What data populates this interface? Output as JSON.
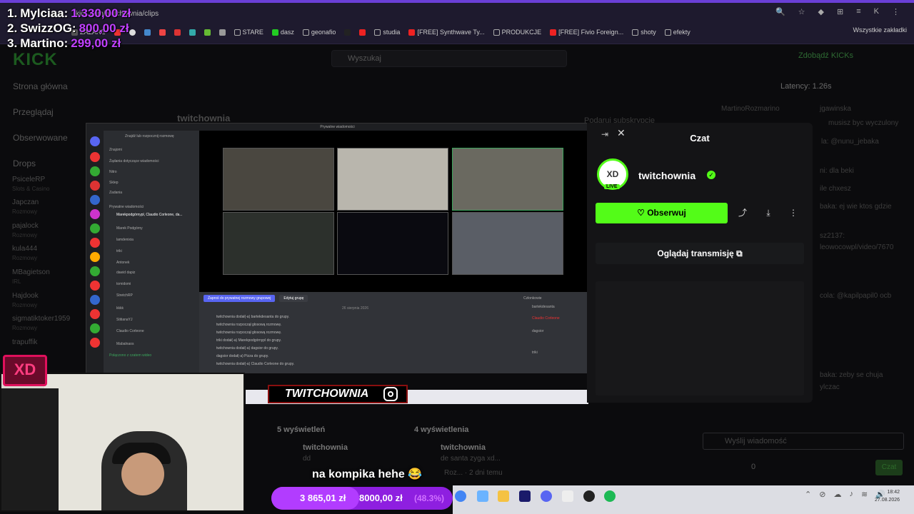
{
  "browser": {
    "url": "kick.com/twitchownia/clips",
    "bookmarks": [
      "ZAZARE",
      "STARE",
      "dasz",
      "geonafio",
      "studia",
      "[FREE] Synthwave Ty...",
      "PRODUKCJE",
      "[FREE] Fivio Foreign...",
      "shoty",
      "efekty"
    ],
    "bookmarks_all": "Wszystkie zakładki",
    "profile_letter": "K"
  },
  "leaderboard": [
    {
      "rank": "1.",
      "name": "Mylciaa:",
      "amount": "1.330,00 zł"
    },
    {
      "rank": "2.",
      "name": "SwizzOG:",
      "amount": "800,00 zł"
    },
    {
      "rank": "3.",
      "name": "Martino:",
      "amount": "299,00 zł"
    }
  ],
  "kick": {
    "logo": "KICK",
    "search_placeholder": "Wyszukaj",
    "get_kicks": "Zdobądź KICKs",
    "nav": [
      "Strona główna",
      "Przeglądaj",
      "Obserwowane"
    ],
    "drops": "Drops",
    "channels": [
      {
        "name": "PsiceleRP",
        "sub": "Slots & Casino"
      },
      {
        "name": "Japczan",
        "sub": "Rozmowy"
      },
      {
        "name": "pajalock",
        "sub": "Rozmowy"
      },
      {
        "name": "kula444",
        "sub": "Rozmowy"
      },
      {
        "name": "MBagietson",
        "sub": "IRL"
      },
      {
        "name": "Hajdook",
        "sub": "Rozmowy"
      },
      {
        "name": "sigmatiktoker1959",
        "sub": "Rozmowy"
      },
      {
        "name": "trapuffik",
        "sub": ""
      }
    ],
    "channel_name": "twitchownia",
    "subscribe": "Podaruj subskrypcję",
    "latency": "Latency: 1.26s",
    "chat_placeholder": "Wyślij wiadomość",
    "chat_btn": "Czat",
    "points": "0",
    "chat_lines": [
      "MartinoRozmarino",
      "jgawinska",
      "musisz byc wyczulony",
      "la: @nunu_jebaka",
      "ni: dla beki",
      "ile chxesz",
      "baka: ej wie ktos gdzie",
      "sz2137:",
      "leowocowpl/video/7670",
      "cola: @kapilpapil0 ocb",
      "baka: zeby se chuja",
      "ylczac"
    ]
  },
  "discord": {
    "title": "Prywatne wiadomości",
    "search": "Znajdź lub rozpocznij rozmowę",
    "menu": [
      "Znajomi",
      "Żądania dotyczące wiadomości",
      "Nitro",
      "Sklep",
      "Zadania"
    ],
    "dm_header": "Prywatne wiadomości",
    "dms": [
      "Marekpodgórnypl, Claudio Corleone, da...",
      "Marek Podgórny",
      "lamdenixia",
      "triki",
      "Antonek",
      "dawid dapiz",
      "tomidomi",
      "StretchRP",
      "kkkk",
      "StitianaYJ",
      "Claudio Corleone",
      "Mabalnaos"
    ],
    "invite_btn": "Zaproś do prywatnej rozmowy grupowej",
    "edit_btn": "Edytuj grupę",
    "chat_date": "26 sierpnia 2026",
    "log": [
      "twitchownia dodał(-a) bartekdesanta do grupy.",
      "twitchownia rozpoczął głosową rozmowę.",
      "twitchownia rozpoczął głosową rozmowę.",
      "triki dodał(-a) Marekpodgórnypl do grupy.",
      "twitchownia dodał(-a) dagsior do grupy.",
      "dagsior dodał(-a) Pizza do grupy.",
      "twitchownia dodał(-a) Claudio Corleone do grupy."
    ],
    "members_title": "Członkowie",
    "members": [
      "bartekdesanta",
      "Claudio Corleone",
      "dagsior",
      "triki"
    ],
    "voice_status": "Połączono z czatem wideo"
  },
  "popup": {
    "title": "Czat",
    "channel": "twitchownia",
    "avatar_text": "XD",
    "live": "LIVE",
    "follow": "Obserwuj",
    "watch": "Oglądaj transmisję"
  },
  "overlay": {
    "xd": "XD",
    "banner": "TWITCHOWNIA",
    "subtitle": "na kompika hehe 😂",
    "clips": [
      {
        "views": "5 wyświetleń",
        "channel": "twitchownia",
        "title": "dd"
      },
      {
        "views": "4 wyświetlenia",
        "channel": "twitchownia",
        "title": "de santa zyga xd..."
      }
    ],
    "clip_meta": "Roz... · 2 dni temu",
    "donation_current": "3 865,01 zł",
    "donation_goal": "8000,00 zł",
    "donation_pct": "(48.3%)",
    "donation_progress": 0.483
  },
  "taskbar": {
    "time": "18:42",
    "date": "27.08.2026"
  },
  "colors": {
    "kick_green": "#53fc18",
    "purple": "#8e1fe0",
    "leaderboard_amount": "#c040ff"
  }
}
